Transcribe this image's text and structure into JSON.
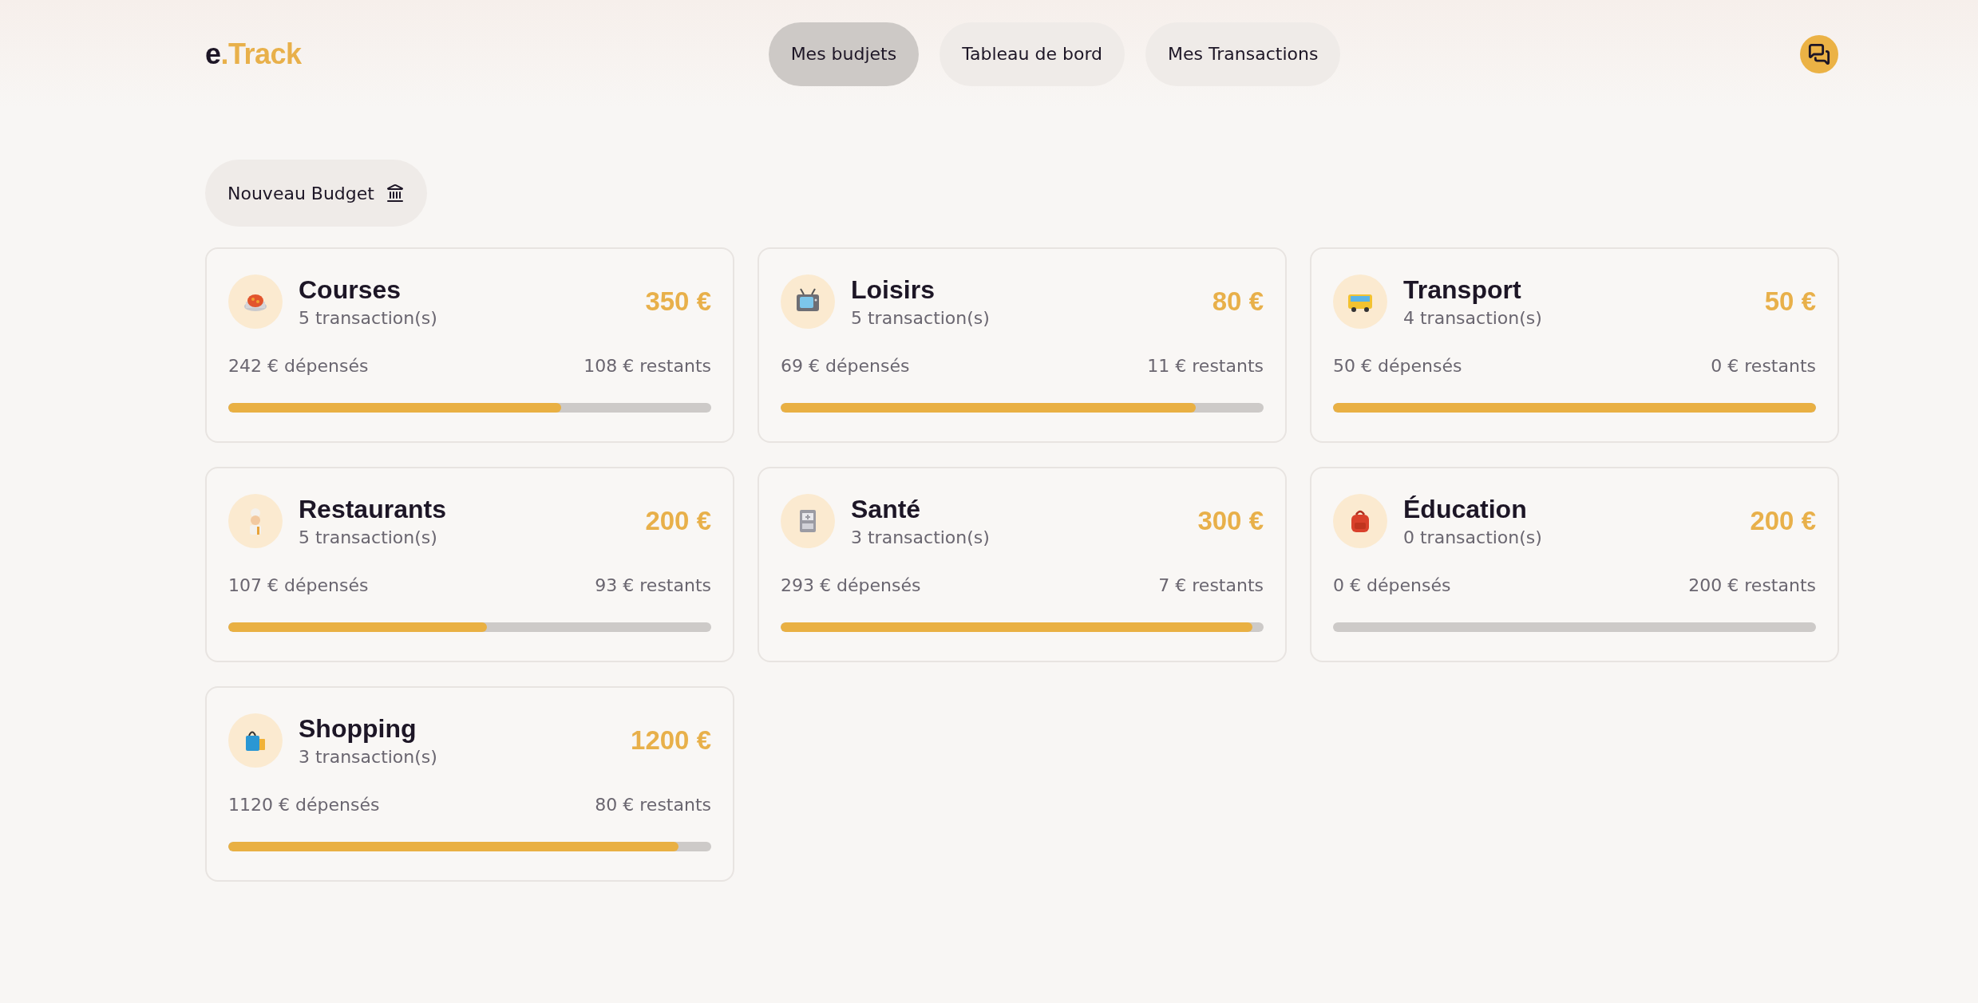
{
  "logo": {
    "prefix": "e",
    "accent": ".Track"
  },
  "nav": [
    {
      "label": "Mes budjets",
      "selected": true
    },
    {
      "label": "Tableau de bord",
      "selected": false
    },
    {
      "label": "Mes Transactions",
      "selected": false
    }
  ],
  "new_budget_button": {
    "label": "Nouveau Budget"
  },
  "budgets": [
    {
      "kind": "pot",
      "name": "Courses",
      "transactions": "5 transaction(s)",
      "amount": "350 €",
      "spent": "242 € dépensés",
      "remaining": "108 € restants",
      "level": 0.69
    },
    {
      "kind": "tv",
      "name": "Loisirs",
      "transactions": "5 transaction(s)",
      "amount": "80 €",
      "spent": "69 € dépensés",
      "remaining": "11 € restants",
      "level": 0.86
    },
    {
      "kind": "bus",
      "name": "Transport",
      "transactions": "4 transaction(s)",
      "amount": "50 €",
      "spent": "50 € dépensés",
      "remaining": "0 € restants",
      "level": 1
    },
    {
      "kind": "chef",
      "name": "Restaurants",
      "transactions": "5 transaction(s)",
      "amount": "200 €",
      "spent": "107 € dépensés",
      "remaining": "93 € restants",
      "level": 0.535
    },
    {
      "kind": "medical",
      "name": "Santé",
      "transactions": "3 transaction(s)",
      "amount": "300 €",
      "spent": "293 € dépensés",
      "remaining": "7 € restants",
      "level": 0.977
    },
    {
      "kind": "backpack",
      "name": "Éducation",
      "transactions": "0 transaction(s)",
      "amount": "200 €",
      "spent": "0 € dépensés",
      "remaining": "200 € restants",
      "level": 0
    },
    {
      "kind": "bag",
      "name": "Shopping",
      "transactions": "3 transaction(s)",
      "amount": "1200 €",
      "spent": "1120 € dépensés",
      "remaining": "80 € restants",
      "level": 0.933
    }
  ]
}
